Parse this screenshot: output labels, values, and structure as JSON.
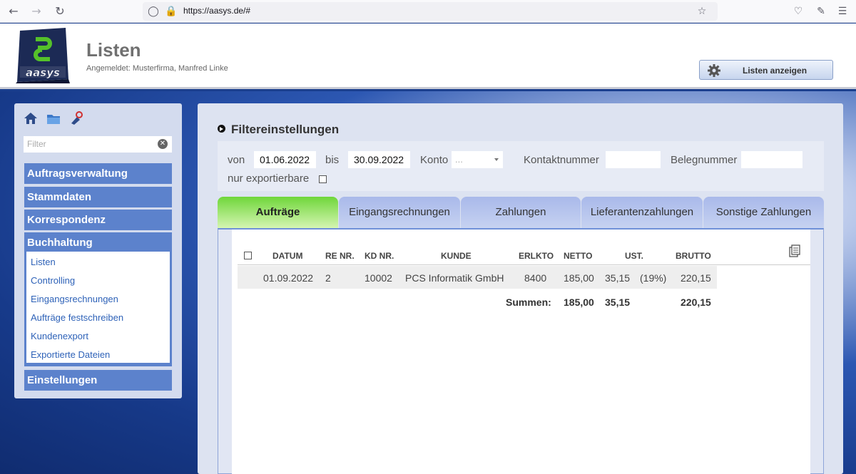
{
  "browser": {
    "url": "https://aasys.de/#"
  },
  "header": {
    "title": "Listen",
    "subtitle": "Angemeldet: Musterfirma, Manfred Linke",
    "action_button": "Listen anzeigen",
    "logo_text": "aasys"
  },
  "sidebar": {
    "filter_placeholder": "Filter",
    "sections": [
      "Auftragsverwaltung",
      "Stammdaten",
      "Korrespondenz",
      "Buchhaltung",
      "Einstellungen"
    ],
    "buchhaltung_items": [
      "Listen",
      "Controlling",
      "Eingangsrechnungen",
      "Aufträge festschreiben",
      "Kundenexport",
      "Exportierte Dateien"
    ]
  },
  "filter": {
    "heading": "Filtereinstellungen",
    "von_label": "von",
    "von_value": "01.06.2022",
    "bis_label": "bis",
    "bis_value": "30.09.2022",
    "konto_label": "Konto",
    "konto_value": "...",
    "kontakt_label": "Kontaktnummer",
    "kontakt_value": "",
    "beleg_label": "Belegnummer",
    "beleg_value": "",
    "export_label": "nur exportierbare"
  },
  "tabs": [
    "Aufträge",
    "Eingangsrechnungen",
    "Zahlungen",
    "Lieferantenzahlungen",
    "Sonstige Zahlungen"
  ],
  "table": {
    "columns": [
      "DATUM",
      "RE NR.",
      "KD NR.",
      "KUNDE",
      "ERLKTO",
      "NETTO",
      "UST.",
      "BRUTTO"
    ],
    "rows": [
      {
        "datum": "01.09.2022",
        "re_nr": "2",
        "kd_nr": "10002",
        "kunde": "PCS Informatik GmbH",
        "erlkto": "8400",
        "netto": "185,00",
        "ust": "35,15",
        "ust_pct": "(19%)",
        "brutto": "220,15"
      }
    ],
    "totals": {
      "label": "Summen:",
      "netto": "185,00",
      "ust": "35,15",
      "brutto": "220,15"
    }
  },
  "colors": {
    "accent": "#5c82cc",
    "active_tab": "#6fd63a",
    "link": "#2e62b8"
  }
}
